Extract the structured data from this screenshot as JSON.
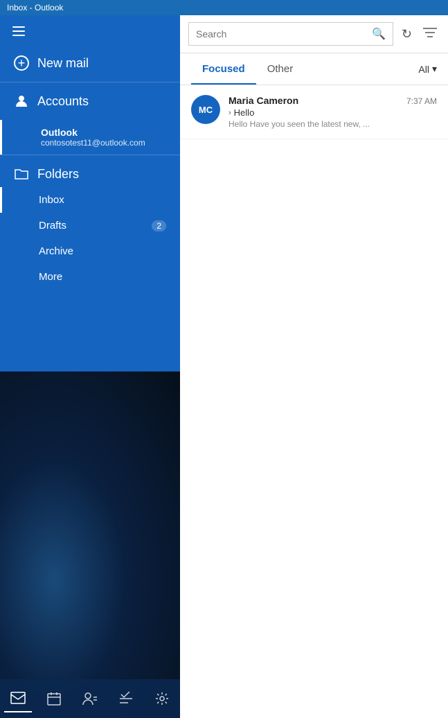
{
  "titleBar": {
    "text": "Inbox - Outlook"
  },
  "sidebar": {
    "hamburger_label": "Menu",
    "newMail": {
      "label": "New mail"
    },
    "accounts": {
      "label": "Accounts",
      "items": [
        {
          "name": "Outlook",
          "email": "contosotest11@outlook.com"
        }
      ]
    },
    "folders": {
      "label": "Folders",
      "items": [
        {
          "name": "Inbox",
          "badge": null,
          "active": true
        },
        {
          "name": "Drafts",
          "badge": "2",
          "active": false
        },
        {
          "name": "Archive",
          "badge": null,
          "active": false
        },
        {
          "name": "More",
          "badge": null,
          "active": false
        }
      ]
    },
    "bottomNav": [
      {
        "id": "mail",
        "icon": "✉",
        "active": true
      },
      {
        "id": "calendar",
        "icon": "⊞",
        "active": false
      },
      {
        "id": "contacts",
        "icon": "👤",
        "active": false
      },
      {
        "id": "tasks",
        "icon": "✓",
        "active": false
      },
      {
        "id": "settings",
        "icon": "⚙",
        "active": false
      }
    ]
  },
  "contentArea": {
    "searchBar": {
      "placeholder": "Search",
      "refreshIcon": "↻",
      "filterIcon": "≡"
    },
    "tabs": [
      {
        "id": "focused",
        "label": "Focused",
        "active": true
      },
      {
        "id": "other",
        "label": "Other",
        "active": false
      }
    ],
    "tabAllLabel": "All",
    "emails": [
      {
        "id": 1,
        "avatar_initials": "MC",
        "sender": "Maria Cameron",
        "subject": "Hello",
        "preview": "Hello Have you seen the latest new, ...",
        "time": "7:37 AM",
        "hasReply": true
      }
    ]
  }
}
